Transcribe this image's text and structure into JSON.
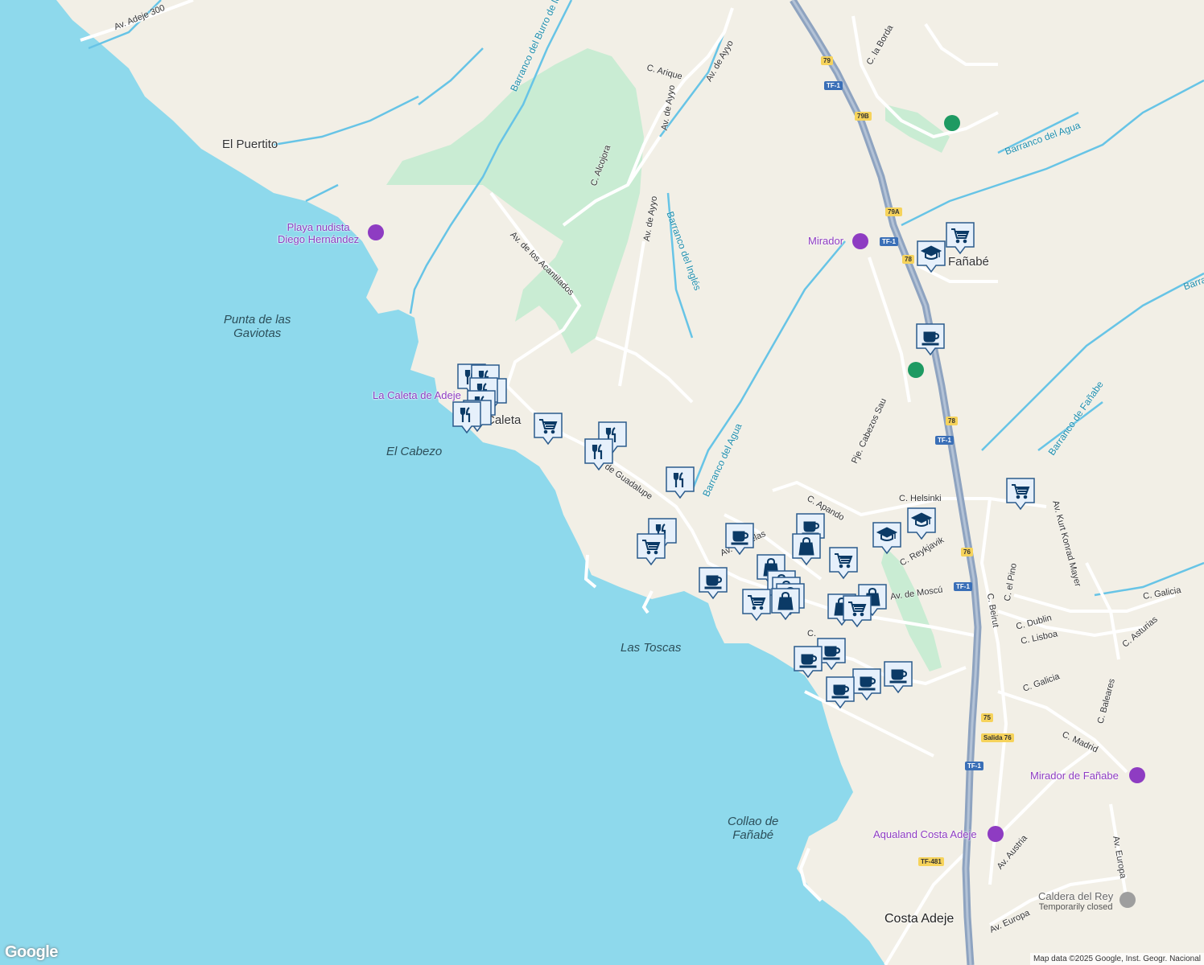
{
  "colors": {
    "land": "#f2efe6",
    "sea": "#8ed9ec",
    "green": "#c9ecd3",
    "road": "#ffffff",
    "highway": "#8ea3c0",
    "river": "#67c4e6",
    "pin_fill": "#e6f0fb",
    "pin_stroke": "#2b5b8c",
    "pin_icon": "#0b3a66",
    "poi_purple": "#8e3cc2",
    "poi_green": "#1e9a62"
  },
  "places": {
    "el_puertito": "El Puertito",
    "punta_line1": "Punta de las",
    "punta_line2": "Gaviotas",
    "el_cabezo": "El Cabezo",
    "las_toscas": "Las Toscas",
    "collao_line1": "Collao de",
    "collao_line2": "Fañabé",
    "caleta": "Caleta",
    "fanabe": "Fañabé",
    "costa_adeje": "Costa Adeje"
  },
  "pois": {
    "playa_line1": "Playa nudista",
    "playa_line2": "Diego Hernández",
    "caleta_adeje": "La Caleta de Adeje",
    "mirador": "Mirador",
    "mirador_fanabe": "Mirador de Fañabe",
    "aqualand": "Aqualand Costa Adeje",
    "caldera": "Caldera del Rey",
    "caldera_status": "Temporarily closed"
  },
  "streets": {
    "av_adeje": "Av. Adeje 300",
    "c_arique": "C. Arique",
    "av_ayyo1": "Av. de Ayyo",
    "av_ayyo2": "Av. de Ayyo",
    "av_ayyo3": "Av. de Ayyo",
    "c_alcojora": "C. Alcojora",
    "av_acantilados": "Av. de los Acantilados",
    "av_guadalupe": "Av. de Guadalupe",
    "c_la_borda": "C. la Borda",
    "c_helsinki": "C. Helsinki",
    "c_reykjavik": "C. Reykjavik",
    "av_kurt": "Av. Kurt Konrad Mayer",
    "av_moscu": "Av. de Moscú",
    "c_el_pino": "C. el Pino",
    "c_beirut": "C. Beirut",
    "c_dublin": "C. Dublin",
    "c_lisboa": "C. Lisboa",
    "c_galicia1": "C. Galicia",
    "c_galicia2": "C. Galicia",
    "c_asturias": "C. Asturias",
    "c_baleares": "C. Baleares",
    "c_madrid": "C. Madrid",
    "av_austria": "Av. Austria",
    "av_europa1": "Av. Europa",
    "av_europa2": "Av. Europa",
    "pje_cabezos": "Pje. Cabezos Sau",
    "c_apando": "C. Apando",
    "av_bruselas": "Av. Bruselas",
    "c_f": "C."
  },
  "waterways": {
    "burro": "Barranco del Burro de Ico",
    "ingles": "Barranco del Inglés",
    "agua1": "Barranco del Agua",
    "agua2": "Barranco del Agua",
    "fanabe": "Barranco de Fañabe",
    "barra": "Barra"
  },
  "shields": {
    "s79": "79",
    "tf1a": "TF-1",
    "s79b": "79B",
    "s79a": "79A",
    "tf1b": "TF-1",
    "s78a": "78",
    "s78b": "78",
    "tf1c": "TF-1",
    "s76": "76",
    "tf1d": "TF-1",
    "s75": "75",
    "salida": "Salida 76",
    "tf1e": "TF-1",
    "tf481": "TF-481"
  },
  "markers": [
    {
      "icon": "restaurant-icon"
    },
    {
      "icon": "restaurant-icon"
    },
    {
      "icon": "restaurant-icon"
    },
    {
      "icon": "restaurant-icon"
    },
    {
      "icon": "restaurant-icon"
    },
    {
      "icon": "restaurant-icon"
    },
    {
      "icon": "restaurant-icon"
    },
    {
      "icon": "shopping-cart-icon"
    },
    {
      "icon": "restaurant-icon"
    },
    {
      "icon": "restaurant-icon"
    },
    {
      "icon": "restaurant-icon"
    },
    {
      "icon": "restaurant-icon"
    },
    {
      "icon": "shopping-cart-icon"
    },
    {
      "icon": "coffee-icon"
    },
    {
      "icon": "coffee-icon"
    },
    {
      "icon": "coffee-icon"
    },
    {
      "icon": "shopping-bag-icon"
    },
    {
      "icon": "shopping-bag-icon"
    },
    {
      "icon": "shopping-bag-icon"
    },
    {
      "icon": "shopping-bag-icon"
    },
    {
      "icon": "shopping-bag-icon"
    },
    {
      "icon": "shopping-bag-icon"
    },
    {
      "icon": "shopping-cart-icon"
    },
    {
      "icon": "shopping-cart-icon"
    },
    {
      "icon": "school-icon"
    },
    {
      "icon": "school-icon"
    },
    {
      "icon": "shopping-cart-icon"
    },
    {
      "icon": "school-icon"
    },
    {
      "icon": "shopping-cart-icon"
    },
    {
      "icon": "coffee-icon"
    },
    {
      "icon": "shopping-bag-icon"
    },
    {
      "icon": "shopping-bag-icon"
    },
    {
      "icon": "shopping-cart-icon"
    },
    {
      "icon": "coffee-icon"
    },
    {
      "icon": "coffee-icon"
    },
    {
      "icon": "coffee-icon"
    },
    {
      "icon": "coffee-icon"
    },
    {
      "icon": "coffee-icon"
    }
  ],
  "branding": {
    "logo": "Google",
    "attribution": "Map data ©2025 Google, Inst. Geogr. Nacional"
  }
}
